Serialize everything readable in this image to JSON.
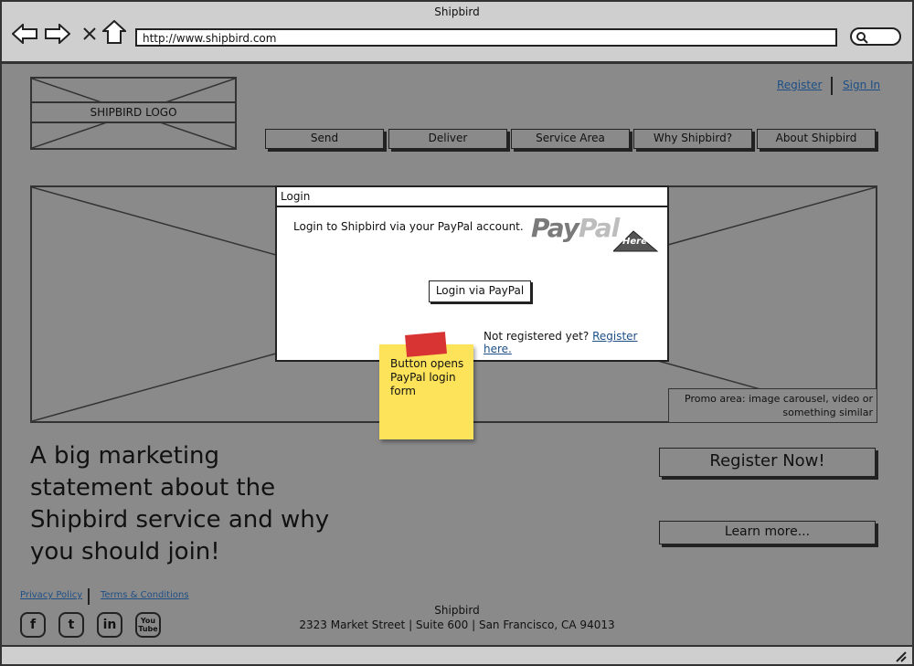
{
  "browser": {
    "title": "Shipbird",
    "url": "http://www.shipbird.com",
    "icons": [
      "back-arrow-icon",
      "forward-arrow-icon",
      "close-icon",
      "home-icon",
      "search-icon"
    ]
  },
  "header": {
    "logo_label": "SHIPBIRD LOGO",
    "register_link": "Register",
    "signin_link": "Sign In",
    "nav": [
      {
        "label": "Send"
      },
      {
        "label": "Deliver"
      },
      {
        "label": "Service Area"
      },
      {
        "label": "Why Shipbird?"
      },
      {
        "label": "About Shipbird"
      }
    ]
  },
  "promo": {
    "caption": "Promo area: image carousel, video or something similar"
  },
  "marketing": {
    "statement": "A big marketing statement about the Shipbird service and why you should join!"
  },
  "cta": {
    "register": "Register Now!",
    "learn": "Learn more..."
  },
  "footer": {
    "privacy": "Privacy Policy",
    "terms": "Terms & Conditions",
    "company": "Shipbird",
    "address": "2323 Market Street  | Suite 600  | San Francisco, CA 94013",
    "social": [
      {
        "icon": "facebook-icon",
        "glyph": "f"
      },
      {
        "icon": "twitter-icon",
        "glyph": "t"
      },
      {
        "icon": "linkedin-icon",
        "glyph": "in"
      },
      {
        "icon": "youtube-icon",
        "glyph": "You Tube"
      }
    ]
  },
  "modal": {
    "title": "Login",
    "intro": "Login to Shipbird via your PayPal account.",
    "paypal_pay": "Pay",
    "paypal_pal": "Pal",
    "paypal_badge": "Here",
    "button": "Login via PayPal",
    "not_registered": "Not registered yet?",
    "register_here": "Register here."
  },
  "sticky_note": {
    "text": "Button opens PayPal login form"
  }
}
